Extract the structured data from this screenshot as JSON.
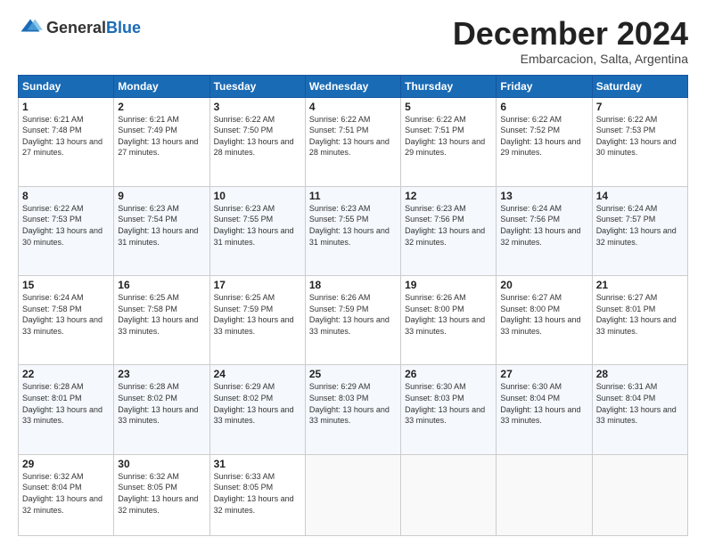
{
  "logo": {
    "general": "General",
    "blue": "Blue"
  },
  "header": {
    "month": "December 2024",
    "location": "Embarcacion, Salta, Argentina"
  },
  "weekdays": [
    "Sunday",
    "Monday",
    "Tuesday",
    "Wednesday",
    "Thursday",
    "Friday",
    "Saturday"
  ],
  "weeks": [
    [
      {
        "day": "1",
        "sunrise": "6:21 AM",
        "sunset": "7:48 PM",
        "daylight": "13 hours and 27 minutes."
      },
      {
        "day": "2",
        "sunrise": "6:21 AM",
        "sunset": "7:49 PM",
        "daylight": "13 hours and 27 minutes."
      },
      {
        "day": "3",
        "sunrise": "6:22 AM",
        "sunset": "7:50 PM",
        "daylight": "13 hours and 28 minutes."
      },
      {
        "day": "4",
        "sunrise": "6:22 AM",
        "sunset": "7:51 PM",
        "daylight": "13 hours and 28 minutes."
      },
      {
        "day": "5",
        "sunrise": "6:22 AM",
        "sunset": "7:51 PM",
        "daylight": "13 hours and 29 minutes."
      },
      {
        "day": "6",
        "sunrise": "6:22 AM",
        "sunset": "7:52 PM",
        "daylight": "13 hours and 29 minutes."
      },
      {
        "day": "7",
        "sunrise": "6:22 AM",
        "sunset": "7:53 PM",
        "daylight": "13 hours and 30 minutes."
      }
    ],
    [
      {
        "day": "8",
        "sunrise": "6:22 AM",
        "sunset": "7:53 PM",
        "daylight": "13 hours and 30 minutes."
      },
      {
        "day": "9",
        "sunrise": "6:23 AM",
        "sunset": "7:54 PM",
        "daylight": "13 hours and 31 minutes."
      },
      {
        "day": "10",
        "sunrise": "6:23 AM",
        "sunset": "7:55 PM",
        "daylight": "13 hours and 31 minutes."
      },
      {
        "day": "11",
        "sunrise": "6:23 AM",
        "sunset": "7:55 PM",
        "daylight": "13 hours and 31 minutes."
      },
      {
        "day": "12",
        "sunrise": "6:23 AM",
        "sunset": "7:56 PM",
        "daylight": "13 hours and 32 minutes."
      },
      {
        "day": "13",
        "sunrise": "6:24 AM",
        "sunset": "7:56 PM",
        "daylight": "13 hours and 32 minutes."
      },
      {
        "day": "14",
        "sunrise": "6:24 AM",
        "sunset": "7:57 PM",
        "daylight": "13 hours and 32 minutes."
      }
    ],
    [
      {
        "day": "15",
        "sunrise": "6:24 AM",
        "sunset": "7:58 PM",
        "daylight": "13 hours and 33 minutes."
      },
      {
        "day": "16",
        "sunrise": "6:25 AM",
        "sunset": "7:58 PM",
        "daylight": "13 hours and 33 minutes."
      },
      {
        "day": "17",
        "sunrise": "6:25 AM",
        "sunset": "7:59 PM",
        "daylight": "13 hours and 33 minutes."
      },
      {
        "day": "18",
        "sunrise": "6:26 AM",
        "sunset": "7:59 PM",
        "daylight": "13 hours and 33 minutes."
      },
      {
        "day": "19",
        "sunrise": "6:26 AM",
        "sunset": "8:00 PM",
        "daylight": "13 hours and 33 minutes."
      },
      {
        "day": "20",
        "sunrise": "6:27 AM",
        "sunset": "8:00 PM",
        "daylight": "13 hours and 33 minutes."
      },
      {
        "day": "21",
        "sunrise": "6:27 AM",
        "sunset": "8:01 PM",
        "daylight": "13 hours and 33 minutes."
      }
    ],
    [
      {
        "day": "22",
        "sunrise": "6:28 AM",
        "sunset": "8:01 PM",
        "daylight": "13 hours and 33 minutes."
      },
      {
        "day": "23",
        "sunrise": "6:28 AM",
        "sunset": "8:02 PM",
        "daylight": "13 hours and 33 minutes."
      },
      {
        "day": "24",
        "sunrise": "6:29 AM",
        "sunset": "8:02 PM",
        "daylight": "13 hours and 33 minutes."
      },
      {
        "day": "25",
        "sunrise": "6:29 AM",
        "sunset": "8:03 PM",
        "daylight": "13 hours and 33 minutes."
      },
      {
        "day": "26",
        "sunrise": "6:30 AM",
        "sunset": "8:03 PM",
        "daylight": "13 hours and 33 minutes."
      },
      {
        "day": "27",
        "sunrise": "6:30 AM",
        "sunset": "8:04 PM",
        "daylight": "13 hours and 33 minutes."
      },
      {
        "day": "28",
        "sunrise": "6:31 AM",
        "sunset": "8:04 PM",
        "daylight": "13 hours and 33 minutes."
      }
    ],
    [
      {
        "day": "29",
        "sunrise": "6:32 AM",
        "sunset": "8:04 PM",
        "daylight": "13 hours and 32 minutes."
      },
      {
        "day": "30",
        "sunrise": "6:32 AM",
        "sunset": "8:05 PM",
        "daylight": "13 hours and 32 minutes."
      },
      {
        "day": "31",
        "sunrise": "6:33 AM",
        "sunset": "8:05 PM",
        "daylight": "13 hours and 32 minutes."
      },
      null,
      null,
      null,
      null
    ]
  ]
}
